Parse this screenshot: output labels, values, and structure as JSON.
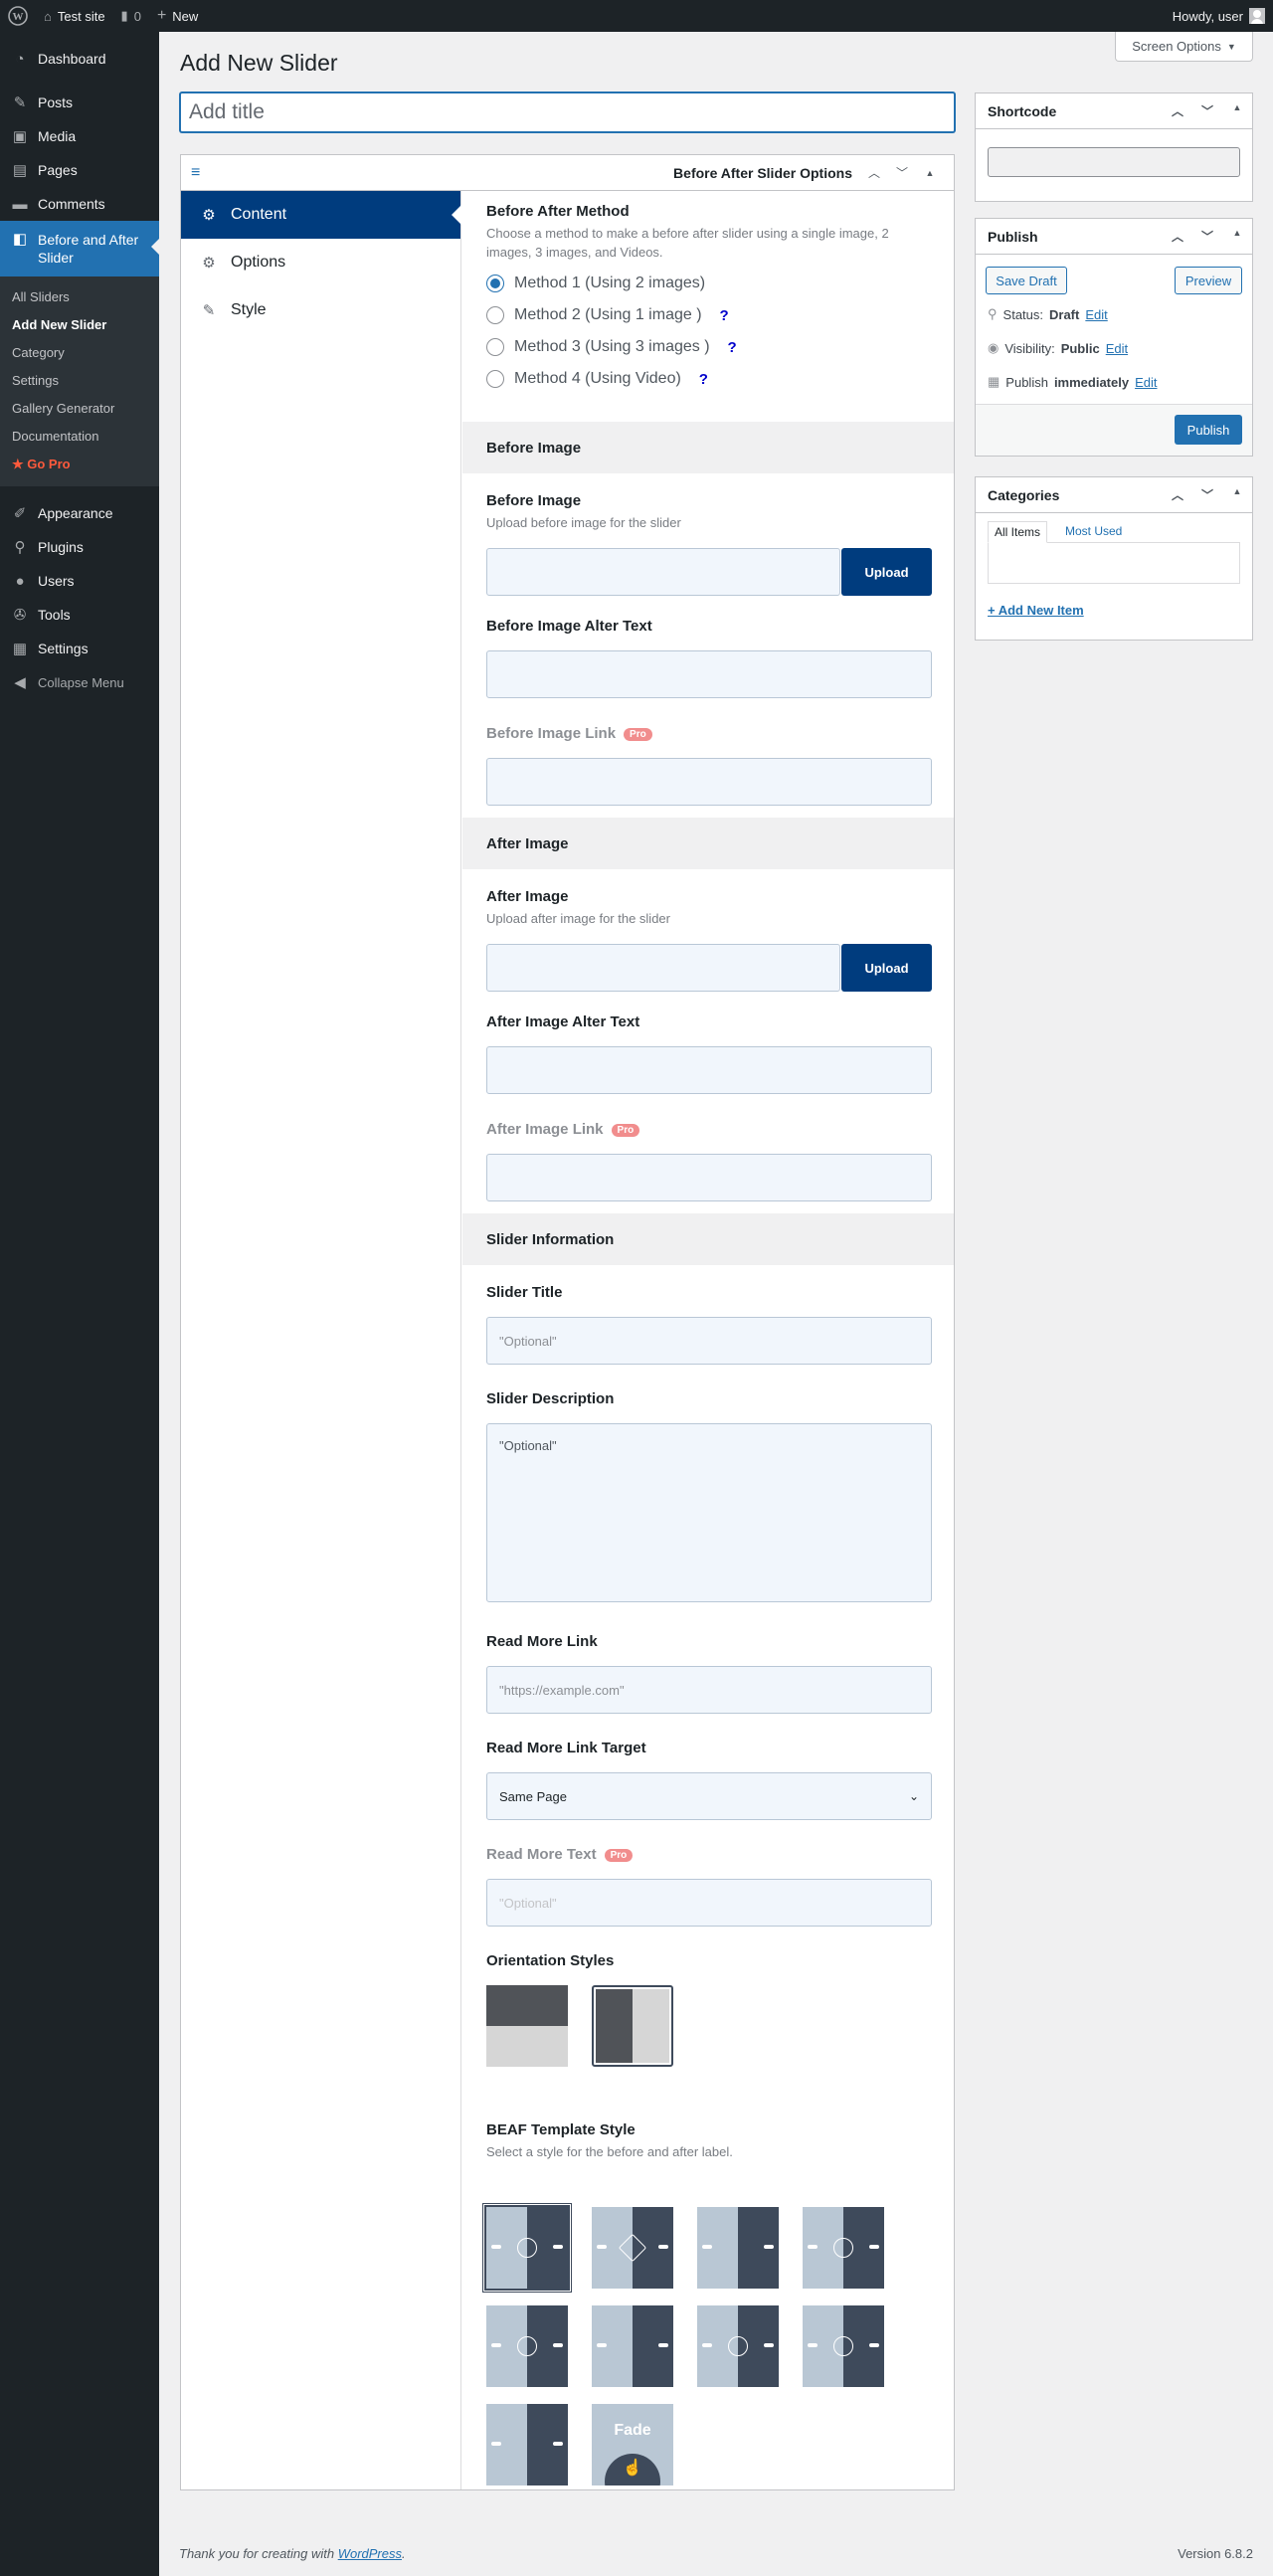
{
  "adminbar": {
    "site": "Test site",
    "comments": "0",
    "new": "New",
    "howdy": "Howdy, user"
  },
  "menu": {
    "dashboard": "Dashboard",
    "posts": "Posts",
    "media": "Media",
    "pages": "Pages",
    "comments": "Comments",
    "current": "Before and After Slider",
    "sub": [
      "All Sliders",
      "Add New Slider",
      "Category",
      "Settings",
      "Gallery Generator",
      "Documentation",
      "★ Go Pro"
    ],
    "appearance": "Appearance",
    "plugins": "Plugins",
    "users": "Users",
    "tools": "Tools",
    "settings": "Settings",
    "collapse": "Collapse Menu"
  },
  "page": {
    "title": "Add New Slider",
    "screen_options": "Screen Options",
    "title_placeholder": "Add title"
  },
  "metabox": {
    "title": "Before After Slider Options",
    "tabs": [
      "Content",
      "Options",
      "Style"
    ]
  },
  "method": {
    "label": "Before After Method",
    "desc": "Choose a method to make a before after slider using a single image, 2 images, 3 images, and Videos.",
    "options": [
      "Method 1 (Using 2 images)",
      "Method 2 (Using 1 image )",
      "Method 3 (Using 3 images )",
      "Method 4 (Using Video)"
    ],
    "selected": 0
  },
  "before": {
    "section": "Before Image",
    "label": "Before Image",
    "desc": "Upload before image for the slider",
    "upload": "Upload",
    "alt_label": "Before Image Alter Text",
    "link_label": "Before Image Link",
    "pro": "Pro"
  },
  "after": {
    "section": "After Image",
    "label": "After Image",
    "desc": "Upload after image for the slider",
    "upload": "Upload",
    "alt_label": "After Image Alter Text",
    "link_label": "After Image Link",
    "pro": "Pro"
  },
  "info": {
    "section": "Slider Information",
    "title_label": "Slider Title",
    "title_ph": "\"Optional\"",
    "desc_label": "Slider Description",
    "desc_ph": "\"Optional\"",
    "readmore_label": "Read More Link",
    "readmore_ph": "\"https://example.com\"",
    "target_label": "Read More Link Target",
    "target_value": "Same Page",
    "text_label": "Read More Text",
    "text_ph": "\"Optional\"",
    "pro": "Pro"
  },
  "orientation": {
    "label": "Orientation Styles"
  },
  "template": {
    "label": "BEAF Template Style",
    "desc": "Select a style for the before and after label.",
    "fade": "Fade"
  },
  "shortcode": {
    "title": "Shortcode"
  },
  "publish": {
    "title": "Publish",
    "save_draft": "Save Draft",
    "preview": "Preview",
    "status_label": "Status:",
    "status": "Draft",
    "visibility_label": "Visibility:",
    "visibility": "Public",
    "publish_label": "Publish",
    "publish_when": "immediately",
    "edit": "Edit",
    "publish_btn": "Publish"
  },
  "categories": {
    "title": "Categories",
    "tab_all": "All Items",
    "tab_used": "Most Used",
    "add": "+ Add New Item"
  },
  "footer": {
    "thanks": "Thank you for creating with",
    "wp": "WordPress",
    "dot": ".",
    "version": "Version 6.8.2"
  },
  "colors": {
    "accent": "#2271b1",
    "navy": "#003c7e",
    "adminbar": "#1d2327"
  }
}
